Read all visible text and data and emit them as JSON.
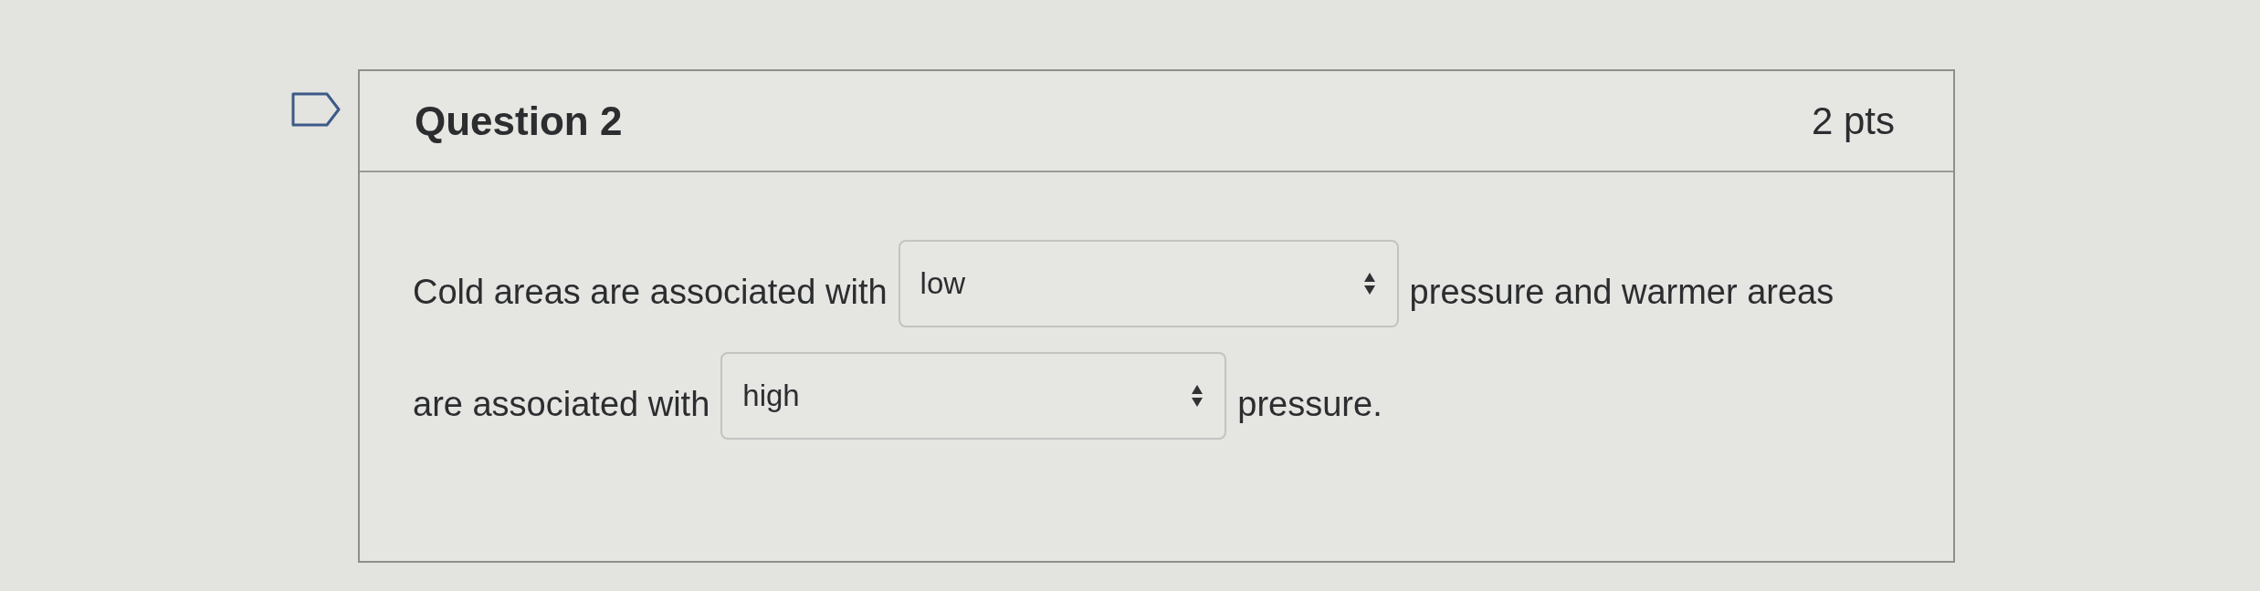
{
  "question": {
    "flagged": false,
    "title": "Question 2",
    "points": "2 pts"
  },
  "body": {
    "lines": [
      [
        {
          "kind": "text",
          "text": "Cold areas are associated with"
        },
        {
          "kind": "select",
          "value": "low"
        },
        {
          "kind": "text",
          "text": "pressure and warmer areas"
        }
      ],
      [
        {
          "kind": "text",
          "text": "are associated with"
        },
        {
          "kind": "select",
          "value": "high"
        },
        {
          "kind": "text",
          "text": "pressure."
        }
      ]
    ]
  }
}
